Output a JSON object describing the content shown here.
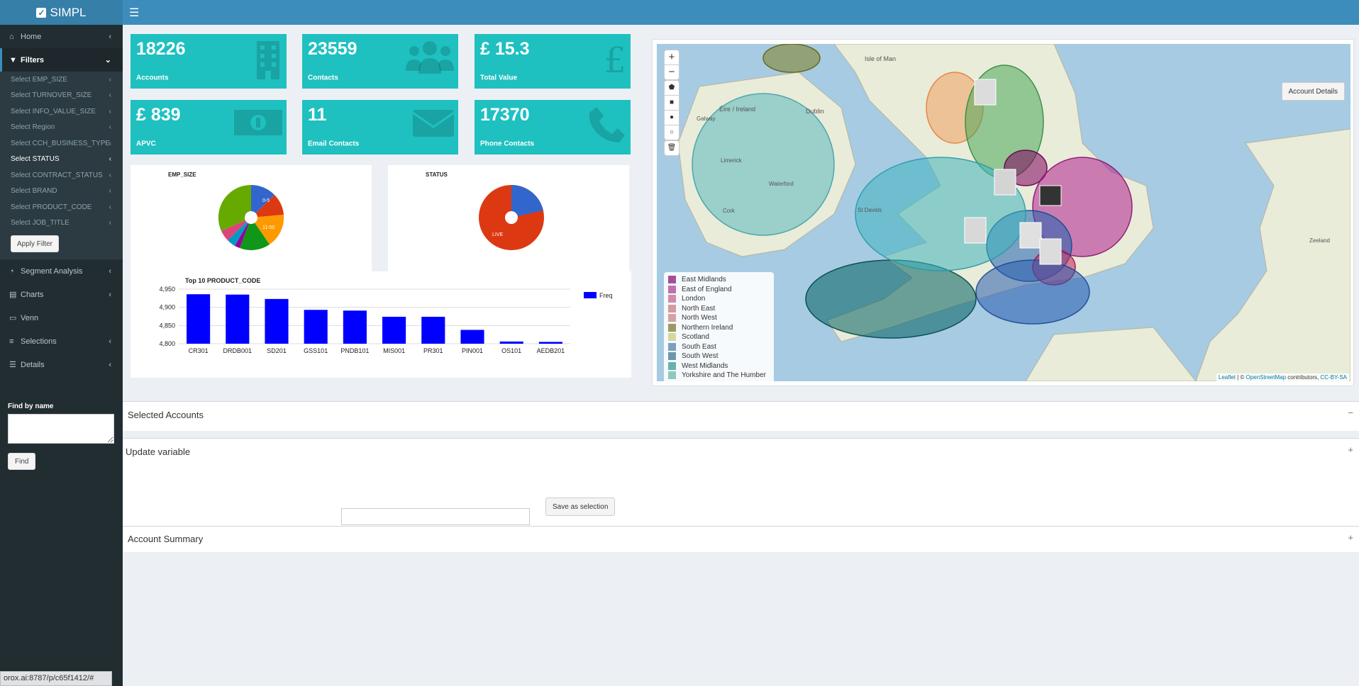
{
  "app": {
    "name": "SIMPL"
  },
  "sidebar": {
    "home": "Home",
    "filters": "Filters",
    "filter_items": [
      "Select EMP_SIZE",
      "Select TURNOVER_SIZE",
      "Select INFO_VALUE_SIZE",
      "Select Region",
      "Select CCH_BUSINESS_TYPE",
      "Select STATUS",
      "Select CONTRACT_STATUS",
      "Select BRAND",
      "Select PRODUCT_CODE",
      "Select JOB_TITLE"
    ],
    "apply_filter": "Apply Filter",
    "segment_analysis": "Segment Analysis",
    "charts": "Charts",
    "venn": "Venn",
    "selections": "Selections",
    "details": "Details",
    "find_by_name_label": "Find by name",
    "find_button": "Find"
  },
  "status_url": "orox.ai:8787/p/c65f1412/#",
  "kpis": [
    {
      "value": "18226",
      "label": "Accounts",
      "icon": "building-icon"
    },
    {
      "value": "23559",
      "label": "Contacts",
      "icon": "users-icon"
    },
    {
      "value": "£ 15.3",
      "label": "Total Value",
      "icon": "pound-icon"
    },
    {
      "value": "£ 839",
      "label": "APVC",
      "icon": "money-icon"
    },
    {
      "value": "11",
      "label": "Email Contacts",
      "icon": "envelope-icon"
    },
    {
      "value": "17370",
      "label": "Phone Contacts",
      "icon": "phone-icon"
    }
  ],
  "pies": {
    "emp_size_title": "EMP_SIZE",
    "emp_size_labels": [
      "0-5",
      "11-50"
    ],
    "status_title": "STATUS",
    "status_label": "LIVE"
  },
  "chart_data": {
    "type": "bar",
    "title": "Top 10 PRODUCT_CODE",
    "categories": [
      "CR301",
      "DRDB001",
      "SD201",
      "GSS101",
      "PNDB101",
      "MIS001",
      "PR301",
      "PIN001",
      "OS101",
      "AEDB201"
    ],
    "series": [
      {
        "name": "Freq",
        "values": [
          4936,
          4935,
          4923,
          4893,
          4891,
          4874,
          4874,
          4838,
          4806,
          4805
        ]
      }
    ],
    "y_ticks": [
      "4,950",
      "4,900",
      "4,850",
      "4,800"
    ],
    "ylim": [
      4800,
      4950
    ],
    "color": "#0000ff",
    "grid": true,
    "legend": "top-right"
  },
  "map": {
    "zoom_in": "+",
    "zoom_out": "−",
    "account_details": "Account Details",
    "place_labels": [
      "Isle of Man",
      "Éire / Ireland",
      "Dublin",
      "Galway",
      "Limerick",
      "Waterford",
      "Cork",
      "St Davids",
      "Zeeland"
    ],
    "legend": [
      {
        "name": "East Midlands",
        "color": "#a3509a"
      },
      {
        "name": "East of England",
        "color": "#c070b0"
      },
      {
        "name": "London",
        "color": "#d28ca8"
      },
      {
        "name": "North East",
        "color": "#d69aa0"
      },
      {
        "name": "North West",
        "color": "#d2a4a0"
      },
      {
        "name": "Northern Ireland",
        "color": "#9a9a60"
      },
      {
        "name": "Scotland",
        "color": "#d6d6a0"
      },
      {
        "name": "South East",
        "color": "#7aa0c0"
      },
      {
        "name": "South West",
        "color": "#6a98aa"
      },
      {
        "name": "West Midlands",
        "color": "#6ab0b0"
      },
      {
        "name": "Yorkshire and The Humber",
        "color": "#8cc8c0"
      }
    ],
    "attribution": {
      "leaflet": "Leaflet",
      "sep": " | © ",
      "osm": "OpenStreetMap",
      "contrib": " contributors, ",
      "license": "CC-BY-SA"
    }
  },
  "sections": {
    "selected_accounts": "Selected Accounts",
    "update_variable": "Update variable",
    "save_as_selection": "Save as selection",
    "account_summary": "Account Summary",
    "collapse": "−",
    "expand": "+"
  }
}
